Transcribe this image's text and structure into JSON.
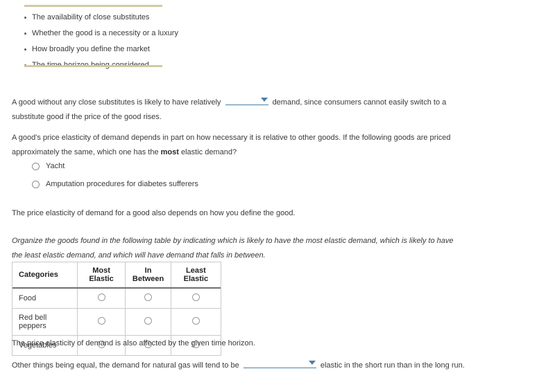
{
  "colors": {
    "divider": "#d2c9a4",
    "dropdown_accent": "#4a7fa8",
    "text": "#3a3a3a",
    "table_border": "#c9c9c9"
  },
  "factors": {
    "items": [
      "The availability of close substitutes",
      "Whether the good is a necessity or a luxury",
      "How broadly you define the market",
      "The time horizon being considered"
    ]
  },
  "substitutes_question": {
    "text_before": "A good without any close substitutes is likely to have relatively",
    "dropdown_value": "",
    "text_after": "demand, since consumers cannot easily switch to a substitute good if the price of the good rises."
  },
  "necessity_question": {
    "prompt_part1": "A good's price elasticity of demand depends in part on how necessary it is relative to other goods. If the following goods are priced approximately the same, which one has the ",
    "prompt_bold": "most",
    "prompt_part2": " elastic demand?",
    "options": [
      "Yacht",
      "Amputation procedures for diabetes sufferers"
    ]
  },
  "define_note": "The price elasticity of demand for a good also depends on how you define the good.",
  "organize_instruction": "Organize the goods found in the following table by indicating which is likely to have the most elastic demand, which is likely to have the least elastic demand, and which will have demand that falls in between.",
  "elasticity_table": {
    "headers": [
      "Categories",
      "Most Elastic",
      "In Between",
      "Least Elastic"
    ],
    "rows": [
      {
        "category": "Food"
      },
      {
        "category": "Red bell peppers"
      },
      {
        "category": "Vegetables"
      }
    ]
  },
  "time_horizon_note": "The price elasticity of demand is also affected by the given time horizon.",
  "natural_gas_question": {
    "text_before": "Other things being equal, the demand for natural gas will tend to be",
    "dropdown_value": "",
    "text_after": "elastic in the short run than in the long run."
  }
}
